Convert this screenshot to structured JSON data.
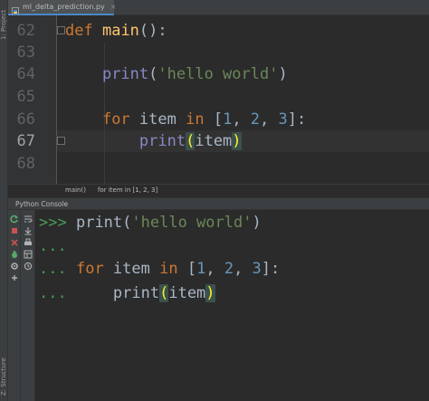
{
  "left_strip": {
    "project_label": "1: Project",
    "structure_label": "Z: Structure"
  },
  "tab": {
    "file_name": "ml_delta_prediction.py",
    "close": "×",
    "icon": "python-file-icon"
  },
  "editor": {
    "line_numbers": [
      "62",
      "63",
      "64",
      "65",
      "66",
      "67",
      "68"
    ],
    "current_line": "67",
    "code": {
      "l62_def": "def",
      "l62_name": "main",
      "l62_rest": "():",
      "l64_indent": "    ",
      "l64_print": "print",
      "l64_open": "(",
      "l64_str": "'hello world'",
      "l64_close": ")",
      "l66_for": "for",
      "l66_item": " item ",
      "l66_in": "in",
      "l66_open": " [",
      "l66_n1": "1",
      "l66_c1": ", ",
      "l66_n2": "2",
      "l66_c2": ", ",
      "l66_n3": "3",
      "l66_close": "]:",
      "l67_print": "print",
      "l67_open": "(",
      "l67_arg": "item",
      "l67_close": ")"
    }
  },
  "breadcrumb": {
    "items": [
      "main()",
      "for item in [1, 2, 3]"
    ]
  },
  "console": {
    "title": "Python Console",
    "lines": {
      "p1": ">>>",
      "c1_print": "print",
      "c1_open": "(",
      "c1_str": "'hello world'",
      "c1_close": ")",
      "p2": "...",
      "p3": "...",
      "c3_for": "for",
      "c3_item": " item ",
      "c3_in": "in",
      "c3_open": " [",
      "c3_n1": "1",
      "c3_c1": ", ",
      "c3_n2": "2",
      "c3_c2": ", ",
      "c3_n3": "3",
      "c3_close": "]:",
      "p4": "...",
      "c4_print": "print",
      "c4_open": "(",
      "c4_arg": "item",
      "c4_close": ")"
    },
    "toolbar_icons": [
      "rerun-icon",
      "stop-icon",
      "close-icon",
      "debug-icon",
      "settings-icon",
      "add-icon",
      "soft-wrap-icon",
      "scroll-to-end-icon",
      "print-icon",
      "show-variables-icon",
      "history-icon"
    ]
  },
  "colors": {
    "background": "#2b2b2b",
    "keyword": "#cc7832",
    "function": "#ffc66d",
    "builtin": "#8888c6",
    "string": "#6a8759",
    "number": "#6897bb",
    "prompt": "#499c54"
  }
}
